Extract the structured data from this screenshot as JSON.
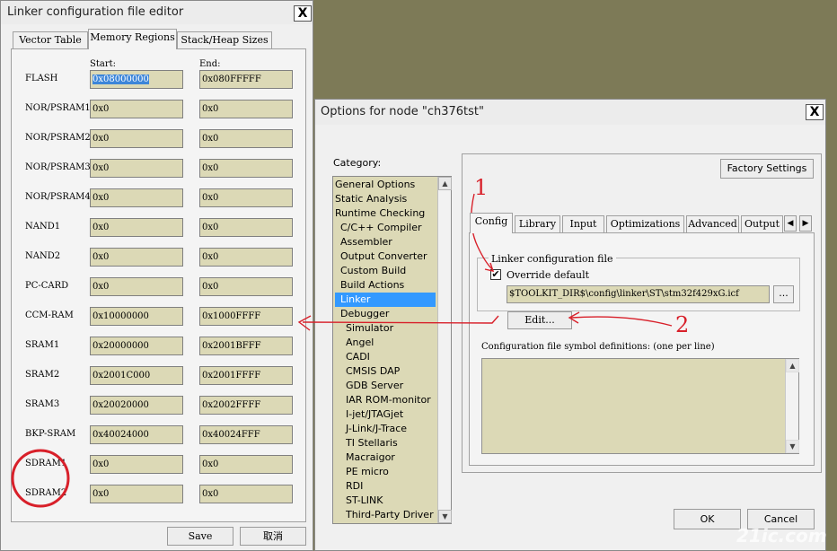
{
  "linker_window": {
    "title": "Linker configuration file editor",
    "close_symbol": "X",
    "tabs": [
      {
        "label": "Vector Table",
        "active": false
      },
      {
        "label": "Memory Regions",
        "active": true
      },
      {
        "label": "Stack/Heap Sizes",
        "active": false
      }
    ],
    "start_header": "Start:",
    "end_header": "End:",
    "regions": [
      {
        "name": "FLASH",
        "start": "0x08000000",
        "end": "0x080FFFFF"
      },
      {
        "name": "NOR/PSRAM1",
        "start": "0x0",
        "end": "0x0"
      },
      {
        "name": "NOR/PSRAM2",
        "start": "0x0",
        "end": "0x0"
      },
      {
        "name": "NOR/PSRAM3",
        "start": "0x0",
        "end": "0x0"
      },
      {
        "name": "NOR/PSRAM4",
        "start": "0x0",
        "end": "0x0"
      },
      {
        "name": "NAND1",
        "start": "0x0",
        "end": "0x0"
      },
      {
        "name": "NAND2",
        "start": "0x0",
        "end": "0x0"
      },
      {
        "name": "PC-CARD",
        "start": "0x0",
        "end": "0x0"
      },
      {
        "name": "CCM-RAM",
        "start": "0x10000000",
        "end": "0x1000FFFF"
      },
      {
        "name": "SRAM1",
        "start": "0x20000000",
        "end": "0x2001BFFF"
      },
      {
        "name": "SRAM2",
        "start": "0x2001C000",
        "end": "0x2001FFFF"
      },
      {
        "name": "SRAM3",
        "start": "0x20020000",
        "end": "0x2002FFFF"
      },
      {
        "name": "BKP-SRAM",
        "start": "0x40024000",
        "end": "0x40024FFF"
      },
      {
        "name": "SDRAM1",
        "start": "0x0",
        "end": "0x0"
      },
      {
        "name": "SDRAM2",
        "start": "0x0",
        "end": "0x0"
      }
    ],
    "save_label": "Save",
    "cancel_label": "取消"
  },
  "options_window": {
    "title": "Options for node \"ch376tst\"",
    "close_symbol": "X",
    "category_label": "Category:",
    "categories": [
      {
        "label": "General Options",
        "indent": 0,
        "selected": false
      },
      {
        "label": "Static Analysis",
        "indent": 0,
        "selected": false
      },
      {
        "label": "Runtime Checking",
        "indent": 0,
        "selected": false
      },
      {
        "label": "C/C++ Compiler",
        "indent": 1,
        "selected": false
      },
      {
        "label": "Assembler",
        "indent": 1,
        "selected": false
      },
      {
        "label": "Output Converter",
        "indent": 1,
        "selected": false
      },
      {
        "label": "Custom Build",
        "indent": 1,
        "selected": false
      },
      {
        "label": "Build Actions",
        "indent": 1,
        "selected": false
      },
      {
        "label": "Linker",
        "indent": 1,
        "selected": true
      },
      {
        "label": "Debugger",
        "indent": 1,
        "selected": false
      },
      {
        "label": "Simulator",
        "indent": 2,
        "selected": false
      },
      {
        "label": "Angel",
        "indent": 2,
        "selected": false
      },
      {
        "label": "CADI",
        "indent": 2,
        "selected": false
      },
      {
        "label": "CMSIS DAP",
        "indent": 2,
        "selected": false
      },
      {
        "label": "GDB Server",
        "indent": 2,
        "selected": false
      },
      {
        "label": "IAR ROM-monitor",
        "indent": 2,
        "selected": false
      },
      {
        "label": "I-jet/JTAGjet",
        "indent": 2,
        "selected": false
      },
      {
        "label": "J-Link/J-Trace",
        "indent": 2,
        "selected": false
      },
      {
        "label": "TI Stellaris",
        "indent": 2,
        "selected": false
      },
      {
        "label": "Macraigor",
        "indent": 2,
        "selected": false
      },
      {
        "label": "PE micro",
        "indent": 2,
        "selected": false
      },
      {
        "label": "RDI",
        "indent": 2,
        "selected": false
      },
      {
        "label": "ST-LINK",
        "indent": 2,
        "selected": false
      },
      {
        "label": "Third-Party Driver",
        "indent": 2,
        "selected": false
      }
    ],
    "factory_settings_label": "Factory Settings",
    "tabs": [
      {
        "label": "Config",
        "active": true
      },
      {
        "label": "Library",
        "active": false
      },
      {
        "label": "Input",
        "active": false
      },
      {
        "label": "Optimizations",
        "active": false
      },
      {
        "label": "Advanced",
        "active": false
      },
      {
        "label": "Output",
        "active": false
      }
    ],
    "tab_scroll_left": "◀",
    "tab_scroll_right": "▶",
    "group_title": "Linker configuration file",
    "override_label": "Override default",
    "override_checked": true,
    "check_mark": "✔",
    "config_path": "$TOOLKIT_DIR$\\config\\linker\\ST\\stm32f429xG.icf",
    "browse_label": "...",
    "edit_label": "Edit...",
    "symbol_defs_label": "Configuration file symbol definitions: (one per line)",
    "symbol_defs_value": "",
    "ok_label": "OK",
    "cancel_label": "Cancel"
  },
  "annotations": {
    "marker_1": "1",
    "marker_2": "2",
    "color": "#d8202a"
  },
  "watermark": "21ic.com"
}
